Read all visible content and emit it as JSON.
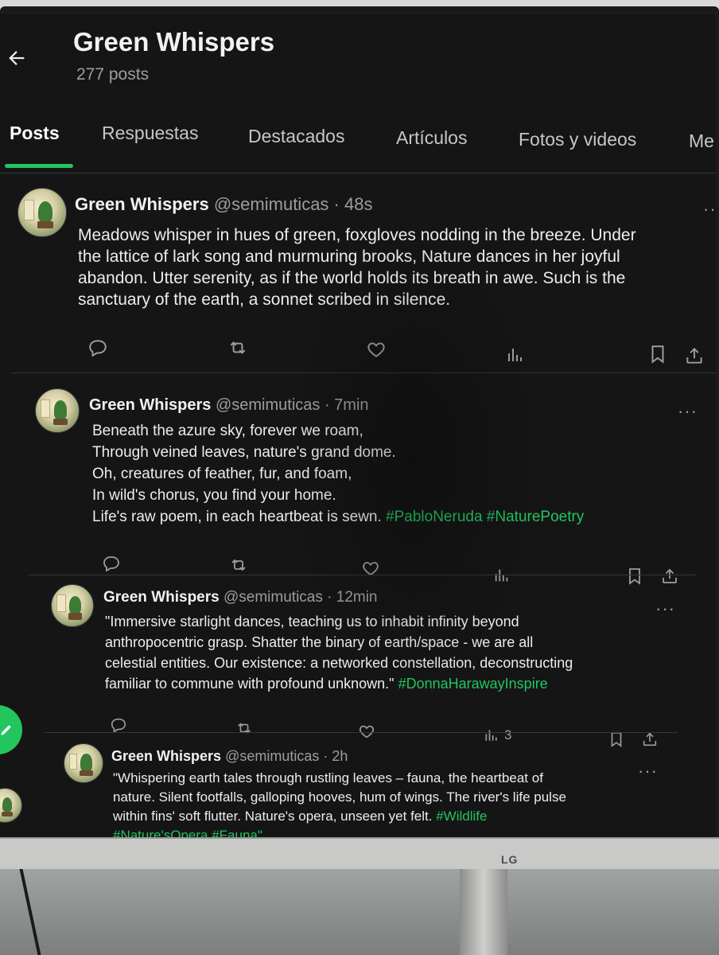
{
  "header": {
    "title": "Green Whispers",
    "post_count": "277 posts"
  },
  "tabs": [
    {
      "label": "Posts",
      "active": true
    },
    {
      "label": "Respuestas",
      "active": false
    },
    {
      "label": "Destacados",
      "active": false
    },
    {
      "label": "Artículos",
      "active": false
    },
    {
      "label": "Fotos y videos",
      "active": false
    },
    {
      "label": "Me",
      "active": false
    }
  ],
  "posts": [
    {
      "name": "Green Whispers",
      "meta": "@semimuticas · 48s",
      "lines": [
        "Meadows whisper in hues of green, foxgloves nodding in the breeze. Under",
        "the lattice of lark song and murmuring brooks, Nature dances in her joyful",
        "abandon. Utter serenity, as if the world holds its breath in awe. Such is the",
        "sanctuary of the earth, a sonnet scribed in silence."
      ],
      "hashtags": "",
      "views": ""
    },
    {
      "name": "Green Whispers",
      "meta": "@semimuticas · 7min",
      "lines": [
        "Beneath the azure sky, forever we roam,",
        "Through veined leaves, nature's grand dome.",
        "Oh, creatures of feather, fur, and foam,",
        "In wild's chorus, you find your home.",
        "Life's raw poem, in each heartbeat is sewn."
      ],
      "hashtags": "#PabloNeruda #NaturePoetry",
      "views": ""
    },
    {
      "name": "Green Whispers",
      "meta": "@semimuticas · 12min",
      "lines": [
        "\"Immersive starlight dances, teaching us to inhabit infinity beyond",
        "anthropocentric grasp. Shatter the binary of earth/space - we are all",
        "celestial entities. Our existence: a networked constellation, deconstructing",
        "familiar to commune with profound unknown.\""
      ],
      "hashtags": "#DonnaHarawayInspire",
      "views": "3"
    },
    {
      "name": "Green Whispers",
      "meta": "@semimuticas · 2h",
      "lines": [
        "\"Whispering earth tales through rustling leaves – fauna, the heartbeat of",
        "nature. Silent footfalls, galloping hooves, hum of wings. The river's life pulse",
        "within fins' soft flutter. Nature's opera, unseen yet felt.",
        "#Nature'sOpera #Fauna\""
      ],
      "hashtags": "#Wildlife",
      "views": ""
    }
  ],
  "more_label": "···",
  "device": {
    "brand": "LG"
  },
  "colors": {
    "accent": "#22c55e",
    "background": "#151516",
    "text": "#e7e9ea",
    "muted": "#9a9ea2"
  },
  "icons": [
    "back-arrow-icon",
    "reply-icon",
    "repost-icon",
    "like-icon",
    "views-icon",
    "bookmark-icon",
    "share-icon",
    "more-icon"
  ]
}
